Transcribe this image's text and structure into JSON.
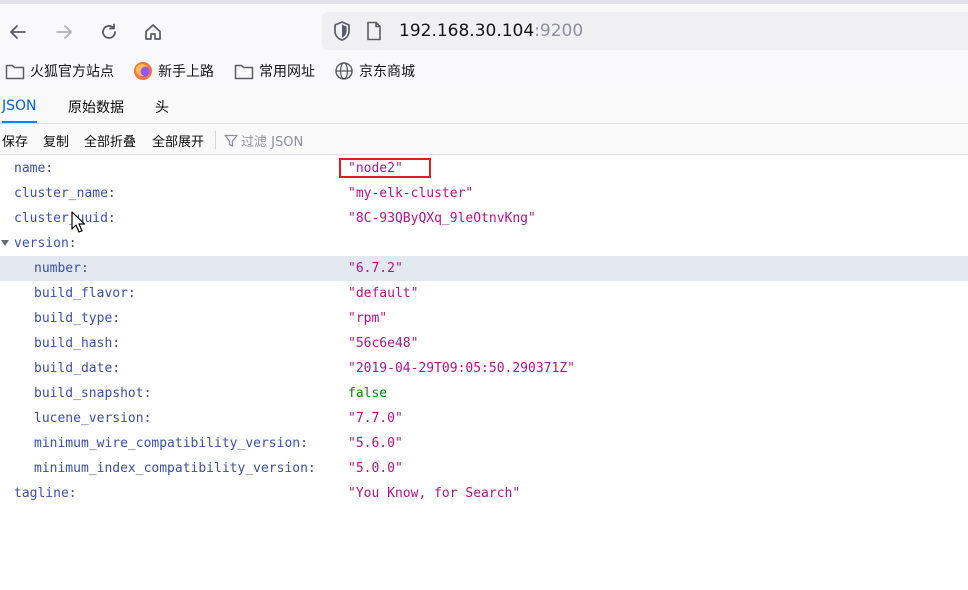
{
  "browser": {
    "url_host": "192.168.30.104",
    "url_port": ":9200",
    "bookmarks": [
      {
        "label": "火狐官方站点",
        "icon": "folder-icon"
      },
      {
        "label": "新手上路",
        "icon": "firefox-icon"
      },
      {
        "label": "常用网址",
        "icon": "folder-icon"
      },
      {
        "label": "京东商城",
        "icon": "globe-icon"
      }
    ]
  },
  "viewer": {
    "tabs": [
      "JSON",
      "原始数据",
      "头"
    ],
    "active_tab": "JSON",
    "toolbar": {
      "save": "保存",
      "copy": "复制",
      "collapse_all": "全部折叠",
      "expand_all": "全部展开",
      "filter_placeholder": "过滤 JSON"
    }
  },
  "json_rows": [
    {
      "key": "name:",
      "value": "\"node2\"",
      "type": "string",
      "highlighted": true
    },
    {
      "key": "cluster_name:",
      "value": "\"my-elk-cluster\"",
      "type": "string"
    },
    {
      "key": "cluster_uuid:",
      "value": "\"8C-93QByQXq_9leOtnvKng\"",
      "type": "string"
    },
    {
      "key": "version:",
      "value": "",
      "type": "object",
      "expanded": true
    },
    {
      "key": "number:",
      "value": "\"6.7.2\"",
      "type": "string",
      "selected": true
    },
    {
      "key": "build_flavor:",
      "value": "\"default\"",
      "type": "string"
    },
    {
      "key": "build_type:",
      "value": "\"rpm\"",
      "type": "string"
    },
    {
      "key": "build_hash:",
      "value": "\"56c6e48\"",
      "type": "string"
    },
    {
      "key": "build_date:",
      "value": "\"2019-04-29T09:05:50.290371Z\"",
      "type": "string"
    },
    {
      "key": "build_snapshot:",
      "value": "false",
      "type": "boolean"
    },
    {
      "key": "lucene_version:",
      "value": "\"7.7.0\"",
      "type": "string"
    },
    {
      "key": "minimum_wire_compatibility_version:",
      "value": "\"5.6.0\"",
      "type": "string"
    },
    {
      "key": "minimum_index_compatibility_version:",
      "value": "\"5.0.0\"",
      "type": "string"
    },
    {
      "key": "tagline:",
      "value": "\"You Know, for Search\"",
      "type": "string"
    }
  ],
  "colors": {
    "json_key": "#3b50a8",
    "json_string": "#b3128c",
    "json_boolean": "#058b00",
    "active_tab": "#0060df",
    "highlight_box": "#e01b24",
    "selected_row": "#e3e8f0"
  }
}
